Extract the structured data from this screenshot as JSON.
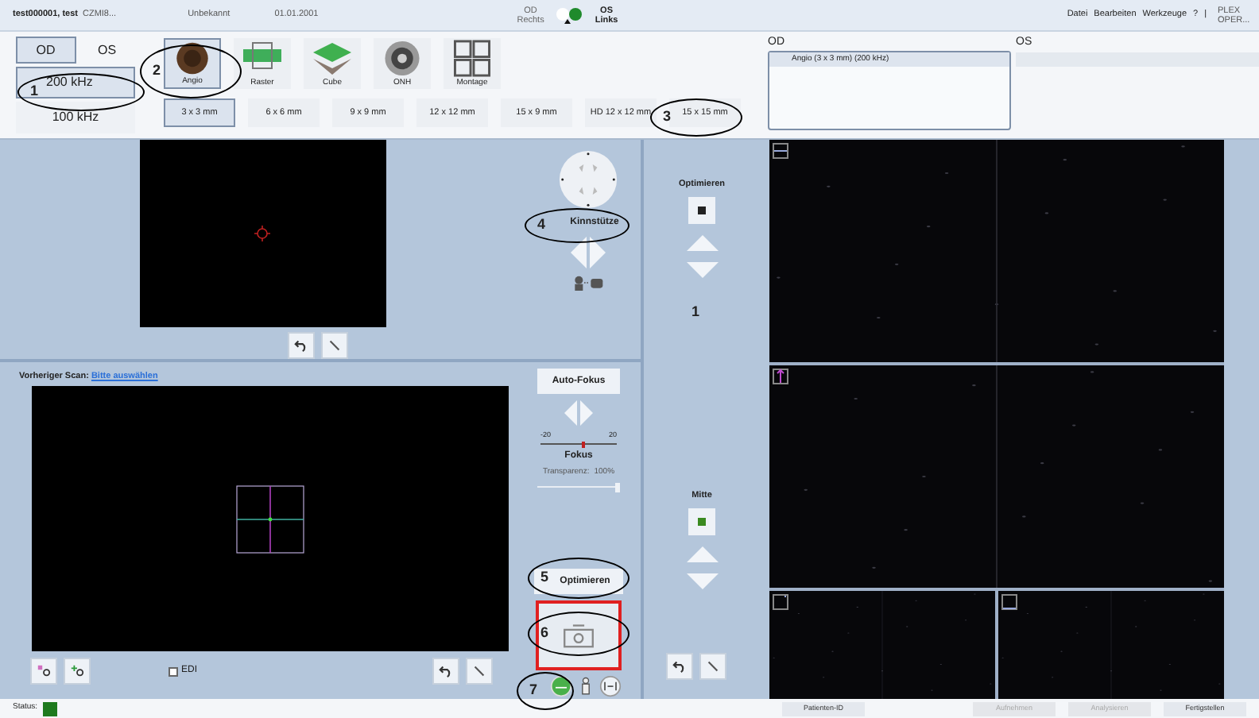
{
  "patient": {
    "name": "test000001, test",
    "id": "CZMI8...",
    "gender": "Unbekannt",
    "birthdate": "01.01.2001"
  },
  "eye_indicator": [
    {
      "label": "OD",
      "sub": "Rechts",
      "selected": false
    },
    {
      "label": "OS",
      "sub": "Links",
      "selected": true
    }
  ],
  "menu": [
    "Datei",
    "Bearbeiten",
    "Werkzeuge",
    "?",
    "|"
  ],
  "app_name": "PLEX OPER...",
  "eye_tabs": [
    {
      "label": "OD",
      "selected": true
    },
    {
      "label": "OS",
      "selected": false
    }
  ],
  "speeds": [
    {
      "label": "200 kHz",
      "selected": true
    },
    {
      "label": "100 kHz",
      "selected": false
    }
  ],
  "scan_types": [
    {
      "label": "Angio",
      "kind": "angio",
      "selected": true
    },
    {
      "label": "Raster",
      "kind": "raster",
      "selected": false
    },
    {
      "label": "Cube",
      "kind": "cube",
      "selected": false
    },
    {
      "label": "ONH",
      "kind": "onh",
      "selected": false
    },
    {
      "label": "Montage",
      "kind": "montage",
      "selected": false
    }
  ],
  "scan_sizes": [
    {
      "label": "3 x 3 mm",
      "selected": true
    },
    {
      "label": "6 x 6 mm",
      "selected": false
    },
    {
      "label": "9 x 9 mm",
      "selected": false
    },
    {
      "label": "12 x 12 mm",
      "selected": false
    },
    {
      "label": "15 x 9 mm",
      "selected": false
    },
    {
      "label": "HD 12 x 12 mm",
      "selected": false
    },
    {
      "label": "15 x 15 mm",
      "selected": false
    }
  ],
  "queue": [
    {
      "header": "OD",
      "items": [
        "Angio (3 x 3 mm) (200 kHz)"
      ]
    },
    {
      "header": "OS"
    }
  ],
  "chinrest": "Kinnstütze",
  "previous_scan": {
    "label": "Vorheriger Scan:",
    "link": "Bitte auswählen"
  },
  "autofocus": "Auto-Fokus",
  "focus": {
    "min": "-20",
    "max": "20",
    "label": "Fokus",
    "level": 0.55
  },
  "transparency": {
    "label": "Transparenz:",
    "value": "100%",
    "level": 1
  },
  "edi": {
    "label": "EDI",
    "checked": false
  },
  "optimize_button": "Optimieren",
  "side_panel": {
    "optimize_label": "Optimieren",
    "count": "1",
    "center_label": "Mitte"
  },
  "status": {
    "label": "Status:"
  },
  "bottom_buttons": [
    {
      "label": "Patienten-ID",
      "disabled": false
    },
    {
      "label": "Aufnehmen",
      "disabled": true
    },
    {
      "label": "Analysieren",
      "disabled": true
    },
    {
      "label": "Fertigstellen",
      "disabled": false
    }
  ],
  "annotations": [
    "1",
    "2",
    "3",
    "4",
    "5",
    "6",
    "7"
  ]
}
